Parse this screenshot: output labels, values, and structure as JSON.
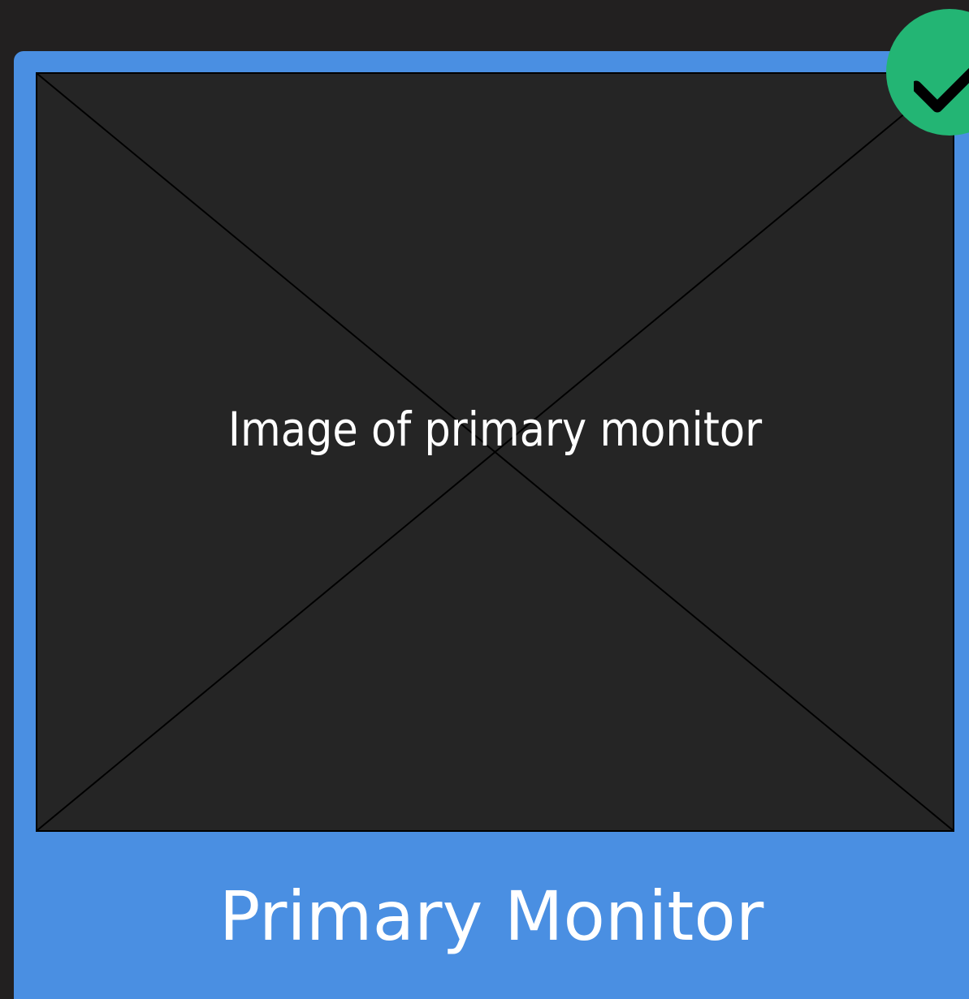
{
  "monitor": {
    "preview_text": "Image of primary monitor",
    "label": "Primary Monitor",
    "selected": true,
    "icon": "checkmark-icon"
  },
  "colors": {
    "background": "#222020",
    "card": "#4a8fe2",
    "preview": "#252525",
    "badge": "#23b574"
  }
}
